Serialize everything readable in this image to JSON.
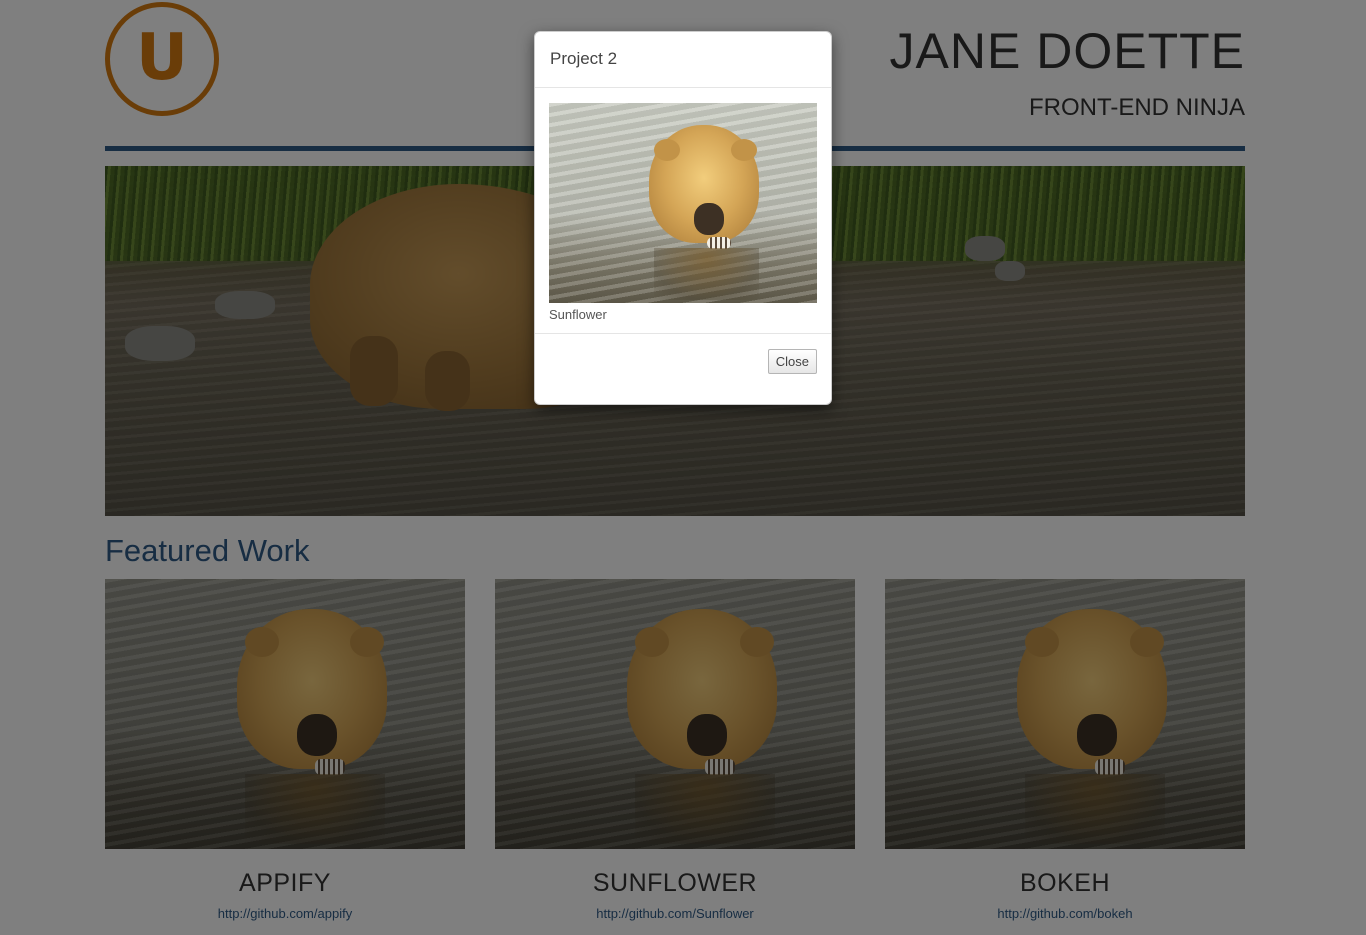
{
  "header": {
    "logo_letter": "U",
    "name": "JANE DOETTE",
    "tagline": "FRONT-END NINJA"
  },
  "section": {
    "title": "Featured Work"
  },
  "projects": [
    {
      "title": "APPIFY",
      "link": "http://github.com/appify"
    },
    {
      "title": "SUNFLOWER",
      "link": "http://github.com/Sunflower"
    },
    {
      "title": "BOKEH",
      "link": "http://github.com/bokeh"
    }
  ],
  "modal": {
    "title": "Project 2",
    "caption": "Sunflower",
    "close_label": "Close"
  },
  "colors": {
    "accent_orange": "#d47a10",
    "accent_blue": "#2f5a86"
  }
}
